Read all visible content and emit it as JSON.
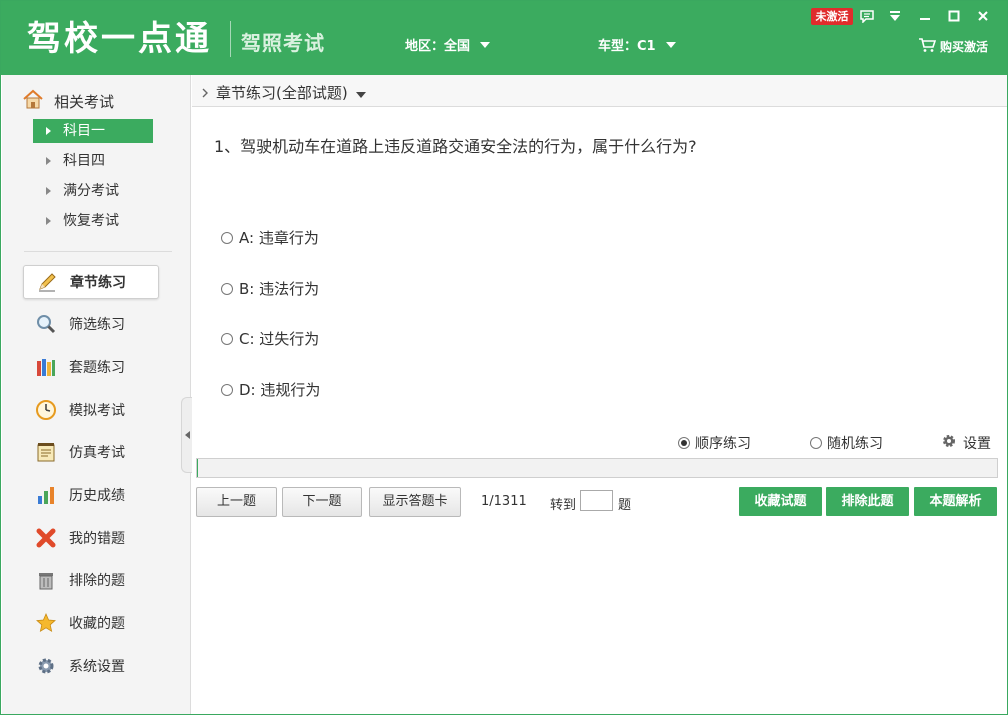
{
  "app": {
    "logo_text": "驾校一点通",
    "subtitle": "驾照考试",
    "badge": "未激活",
    "region_label": "地区：全国",
    "car_type_label": "车型：C1",
    "buy_label": "购买激活",
    "accent_color": "#3bab5f"
  },
  "sidebar": {
    "section_title": "相关考试",
    "sub_items": [
      {
        "label": "科目一",
        "active": true
      },
      {
        "label": "科目四",
        "active": false
      },
      {
        "label": "满分考试",
        "active": false
      },
      {
        "label": "恢复考试",
        "active": false
      }
    ],
    "menu": [
      {
        "label": "章节练习",
        "icon": "pencil-icon",
        "active": true
      },
      {
        "label": "筛选练习",
        "icon": "magnifier-icon",
        "active": false
      },
      {
        "label": "套题练习",
        "icon": "books-icon",
        "active": false
      },
      {
        "label": "模拟考试",
        "icon": "clock-icon",
        "active": false
      },
      {
        "label": "仿真考试",
        "icon": "notepad-icon",
        "active": false
      },
      {
        "label": "历史成绩",
        "icon": "bar-chart-icon",
        "active": false
      },
      {
        "label": "我的错题",
        "icon": "red-x-icon",
        "active": false
      },
      {
        "label": "排除的题",
        "icon": "trash-icon",
        "active": false
      },
      {
        "label": "收藏的题",
        "icon": "star-icon",
        "active": false
      },
      {
        "label": "系统设置",
        "icon": "gear-icon",
        "active": false
      }
    ]
  },
  "main": {
    "breadcrumb": "章节练习(全部试题)",
    "question": "1、驾驶机动车在道路上违反道路交通安全法的行为，属于什么行为?",
    "options": [
      "A: 违章行为",
      "B: 违法行为",
      "C: 过失行为",
      "D: 违规行为"
    ],
    "mode_sequential": "顺序练习",
    "mode_random": "随机练习",
    "selected_mode": "sequential",
    "settings_label": "设置",
    "progress_fraction": 0.0008,
    "prev_label": "上一题",
    "next_label": "下一题",
    "card_label": "显示答题卡",
    "page_info": "1/1311",
    "goto_label": "转到",
    "goto_value": "",
    "goto_suffix": "题",
    "favorite_label": "收藏试题",
    "exclude_label": "排除此题",
    "analysis_label": "本题解析"
  }
}
